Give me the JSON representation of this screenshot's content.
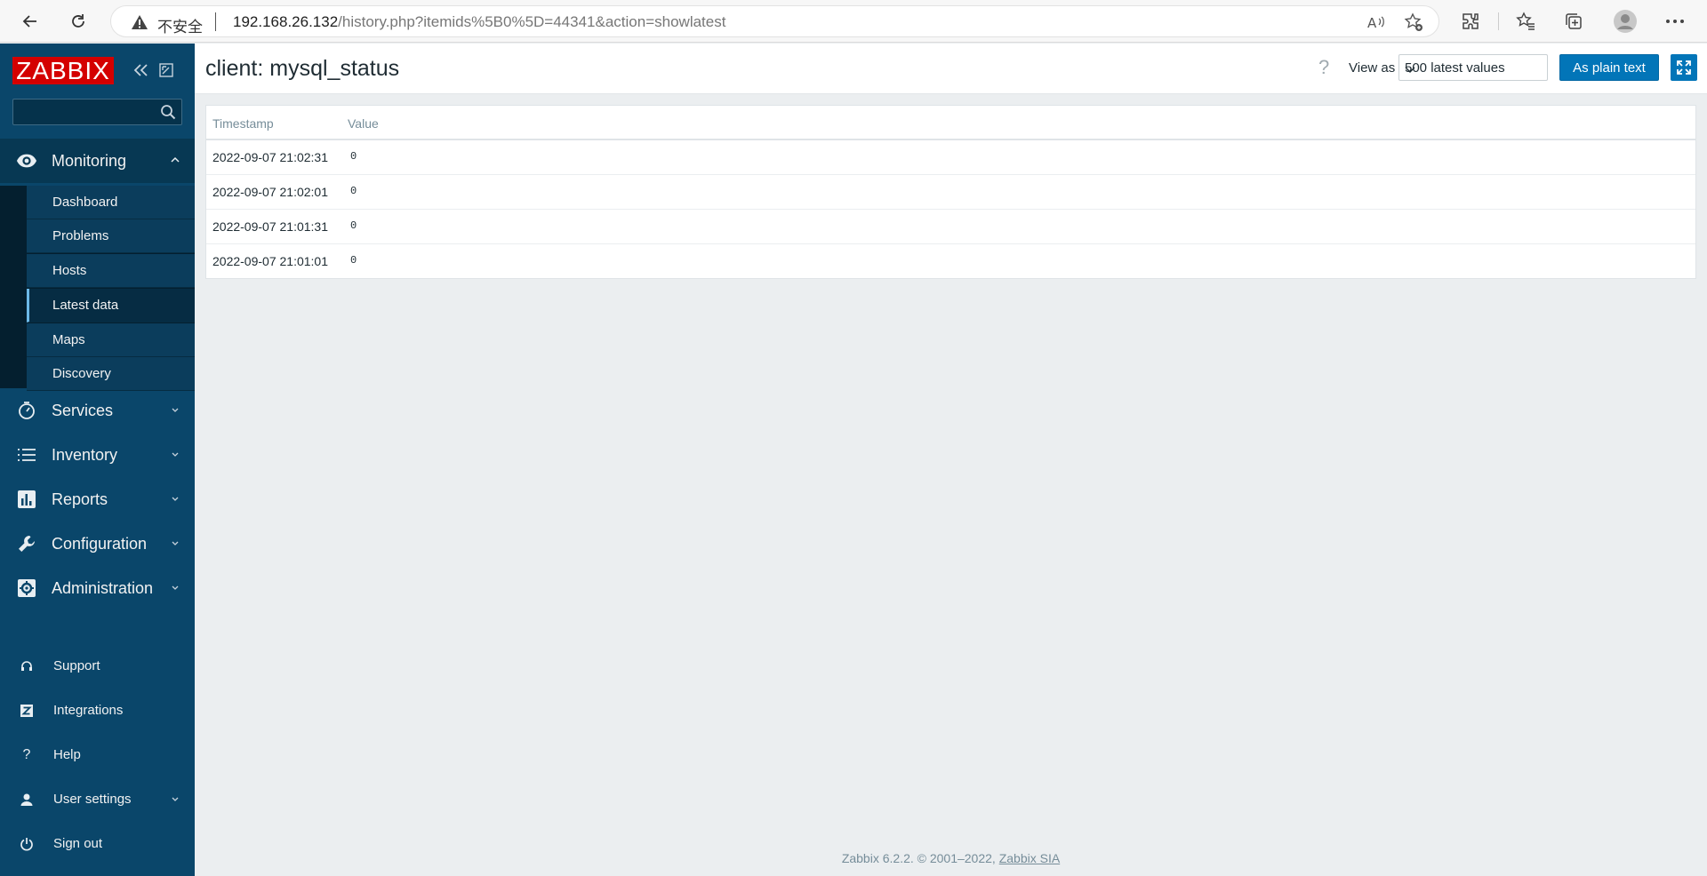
{
  "browser": {
    "insecure_label": "不安全",
    "url_host": "192.168.26.132",
    "url_path": "/history.php?itemids%5B0%5D=44341&action=showlatest"
  },
  "sidebar": {
    "logo": "ZABBIX",
    "search_placeholder": "",
    "monitoring": {
      "label": "Monitoring",
      "items": [
        {
          "label": "Dashboard"
        },
        {
          "label": "Problems"
        },
        {
          "label": "Hosts"
        },
        {
          "label": "Latest data",
          "active": true
        },
        {
          "label": "Maps"
        },
        {
          "label": "Discovery"
        }
      ]
    },
    "sections": [
      {
        "label": "Services",
        "icon": "services-icon"
      },
      {
        "label": "Inventory",
        "icon": "list-icon"
      },
      {
        "label": "Reports",
        "icon": "bar-chart-icon"
      },
      {
        "label": "Configuration",
        "icon": "wrench-icon"
      },
      {
        "label": "Administration",
        "icon": "gear-icon"
      }
    ],
    "bottom": [
      {
        "label": "Support",
        "icon": "headset-icon"
      },
      {
        "label": "Integrations",
        "icon": "zabbix-z-icon"
      },
      {
        "label": "Help",
        "icon": "question-icon"
      },
      {
        "label": "User settings",
        "icon": "user-icon"
      },
      {
        "label": "Sign out",
        "icon": "power-icon"
      }
    ]
  },
  "header": {
    "title": "client: mysql_status",
    "help": "?",
    "view_as_label": "View as",
    "view_as_value": "500 latest values",
    "plain_text_button": "As plain text"
  },
  "table": {
    "columns": [
      "Timestamp",
      "Value"
    ],
    "rows": [
      {
        "timestamp": "2022-09-07 21:02:31",
        "value": "0"
      },
      {
        "timestamp": "2022-09-07 21:02:01",
        "value": "0"
      },
      {
        "timestamp": "2022-09-07 21:01:31",
        "value": "0"
      },
      {
        "timestamp": "2022-09-07 21:01:01",
        "value": "0"
      }
    ]
  },
  "footer": {
    "text": "Zabbix 6.2.2. © 2001–2022, ",
    "link": "Zabbix SIA"
  },
  "colors": {
    "sidebar": "#0a466a",
    "logo_red": "#d40000",
    "primary_button": "#0275b8",
    "background": "#ebeef0"
  }
}
